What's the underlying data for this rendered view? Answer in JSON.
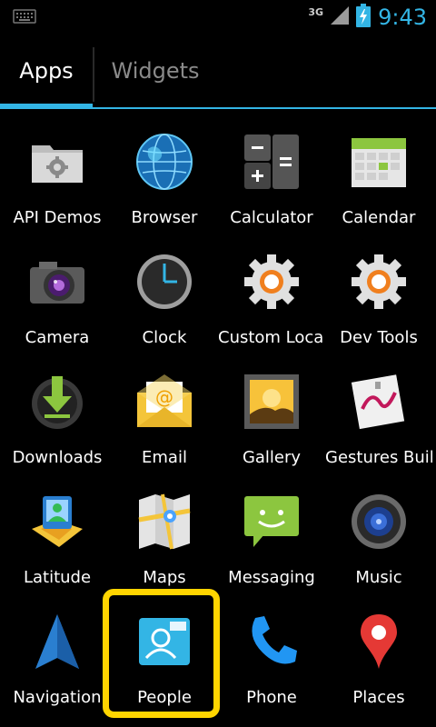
{
  "statusbar": {
    "network": "3G",
    "time": "9:43",
    "icons": [
      "keyboard-icon",
      "signal-icon",
      "battery-charging-icon"
    ]
  },
  "tabs": [
    {
      "label": "Apps",
      "selected": true
    },
    {
      "label": "Widgets",
      "selected": false
    }
  ],
  "apps": [
    {
      "label": "API Demos",
      "icon": "folder-gear-icon"
    },
    {
      "label": "Browser",
      "icon": "globe-icon"
    },
    {
      "label": "Calculator",
      "icon": "calculator-icon"
    },
    {
      "label": "Calendar",
      "icon": "calendar-icon"
    },
    {
      "label": "Camera",
      "icon": "camera-icon"
    },
    {
      "label": "Clock",
      "icon": "clock-icon"
    },
    {
      "label": "Custom Local",
      "icon": "gear-icon"
    },
    {
      "label": "Dev Tools",
      "icon": "gear-icon"
    },
    {
      "label": "Downloads",
      "icon": "download-icon"
    },
    {
      "label": "Email",
      "icon": "email-icon"
    },
    {
      "label": "Gallery",
      "icon": "gallery-icon"
    },
    {
      "label": "Gestures Buil",
      "icon": "gestures-icon"
    },
    {
      "label": "Latitude",
      "icon": "latitude-icon"
    },
    {
      "label": "Maps",
      "icon": "maps-icon"
    },
    {
      "label": "Messaging",
      "icon": "messaging-icon"
    },
    {
      "label": "Music",
      "icon": "speaker-icon"
    },
    {
      "label": "Navigation",
      "icon": "navigation-arrow-icon"
    },
    {
      "label": "People",
      "icon": "contacts-icon",
      "highlighted": true
    },
    {
      "label": "Phone",
      "icon": "phone-icon"
    },
    {
      "label": "Places",
      "icon": "map-pin-icon"
    }
  ],
  "colors": {
    "accent": "#33b5e5",
    "highlight": "#ffd500",
    "background": "#000000"
  }
}
